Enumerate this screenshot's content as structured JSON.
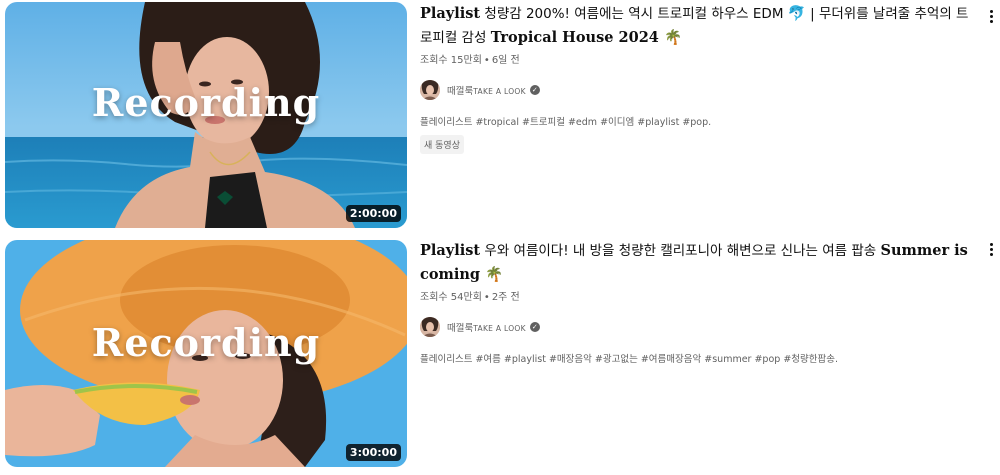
{
  "videos": [
    {
      "title_latin_1": "Playlist",
      "title_ko_1": " 청량감 200%! 여름에는 역시 트로피컬 하우스 EDM ",
      "title_ko_2": " | 무더위를 날려줄 추억의 트로피컬 감성 ",
      "title_latin_2": "Tropical House 2024",
      "title_emoji_1": "🐬",
      "title_emoji_2": "🌴",
      "views": "조회수 15만회",
      "age": "6일 전",
      "channel_name": "때껄룩",
      "channel_sub": "TAKE A LOOK",
      "description": "플레이리스트 #tropical #트로피컬 #edm #이디엠 #playlist #pop.",
      "badge": "새 동영상",
      "thumbnail_text": "Recording",
      "duration": "2:00:00"
    },
    {
      "title_latin_1": "Playlist",
      "title_ko_1": " 우와 여름이다! 내 방을 청량한 캘리포니아 해변으로 신나는 여름 팝송 ",
      "title_latin_2": "Summer is coming",
      "title_emoji_2": "🌴",
      "views": "조회수 54만회",
      "age": "2주 전",
      "channel_name": "때껄룩",
      "channel_sub": "TAKE A LOOK",
      "description": "플레이리스트 #여름 #playlist #매장음악 #광고없는 #여름매장음악 #summer #pop #청량한팝송.",
      "thumbnail_text": "Recording",
      "duration": "3:00:00"
    }
  ],
  "separator": "•",
  "icons": {
    "verified": "verified-check-icon",
    "more": "more-vertical-icon",
    "dolphin": "dolphin-emoji",
    "palm": "palm-tree-emoji"
  }
}
